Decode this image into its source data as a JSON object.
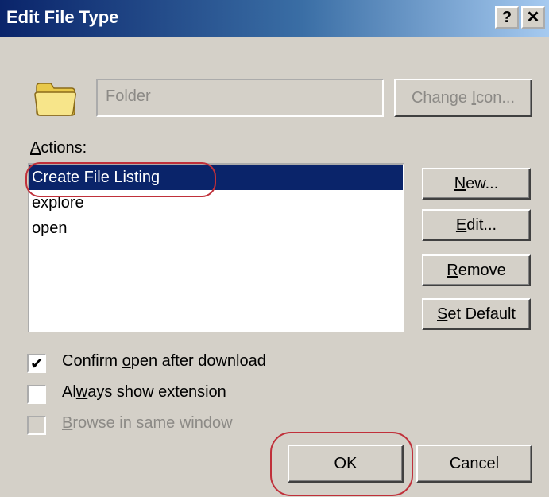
{
  "window": {
    "title": "Edit File Type",
    "help_label": "?",
    "close_label": "✕"
  },
  "icon": {
    "name": "folder-icon"
  },
  "description": {
    "value": "Folder"
  },
  "buttons": {
    "change_icon": {
      "pre": "Change ",
      "mn": "I",
      "post": "con..."
    },
    "new": {
      "pre": "",
      "mn": "N",
      "post": "ew..."
    },
    "edit": {
      "pre": "",
      "mn": "E",
      "post": "dit..."
    },
    "remove": {
      "pre": "",
      "mn": "R",
      "post": "emove"
    },
    "set_default": {
      "pre": "",
      "mn": "S",
      "post": "et Default"
    },
    "ok": "OK",
    "cancel": "Cancel"
  },
  "actions": {
    "label_pre": "",
    "label_mn": "A",
    "label_post": "ctions:",
    "items": [
      {
        "label": "Create File Listing",
        "selected": true
      },
      {
        "label": "explore",
        "selected": false
      },
      {
        "label": "open",
        "selected": false
      },
      {
        "label": "",
        "selected": false
      }
    ]
  },
  "options": {
    "confirm_open": {
      "pre": "Confirm ",
      "mn": "o",
      "post": "pen after download",
      "checked": true
    },
    "always_show": {
      "pre": "Al",
      "mn": "w",
      "post": "ays show extension",
      "checked": false
    },
    "browse_same": {
      "pre": "",
      "mn": "B",
      "post": "rowse in same window",
      "checked": false,
      "disabled": true
    }
  },
  "colors": {
    "title_gradient_start": "#0a246a",
    "selection": "#0a246a",
    "annotation": "#c0303a",
    "face": "#d4d0c8"
  }
}
